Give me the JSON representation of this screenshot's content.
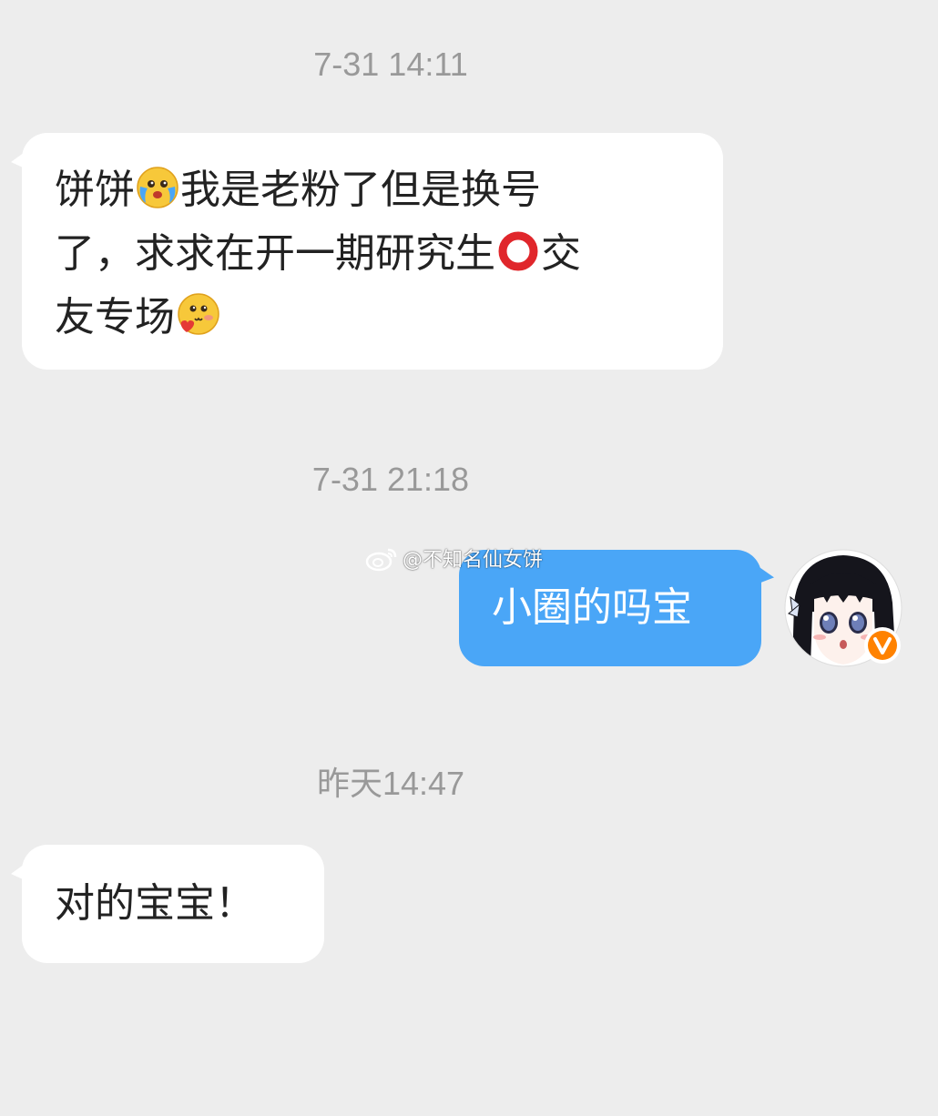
{
  "messages": [
    {
      "timestamp": "7-31 14:11",
      "direction": "incoming",
      "line1_a": "饼饼",
      "line1_b": "我是老粉了但是换号",
      "line2_a": "了，求求在开一期研究生",
      "line2_b": "交",
      "line3_a": "友专场",
      "emojis": [
        "blushing-tear-emoji",
        "red-ring-icon",
        "heart-face-emoji"
      ]
    },
    {
      "timestamp": "7-31 21:18",
      "direction": "outgoing",
      "text": "小圈的吗宝"
    },
    {
      "timestamp": "昨天14:47",
      "direction": "incoming",
      "text": "对的宝宝！"
    }
  ],
  "watermark": {
    "text": "@不知名仙女饼",
    "icon": "weibo-logo-icon"
  },
  "avatar": {
    "badge": "V",
    "badge_color": "#ff8200"
  },
  "colors": {
    "background": "#ededed",
    "incoming_bubble": "#ffffff",
    "outgoing_bubble": "#4aa6f7",
    "timestamp_text": "#999999"
  }
}
